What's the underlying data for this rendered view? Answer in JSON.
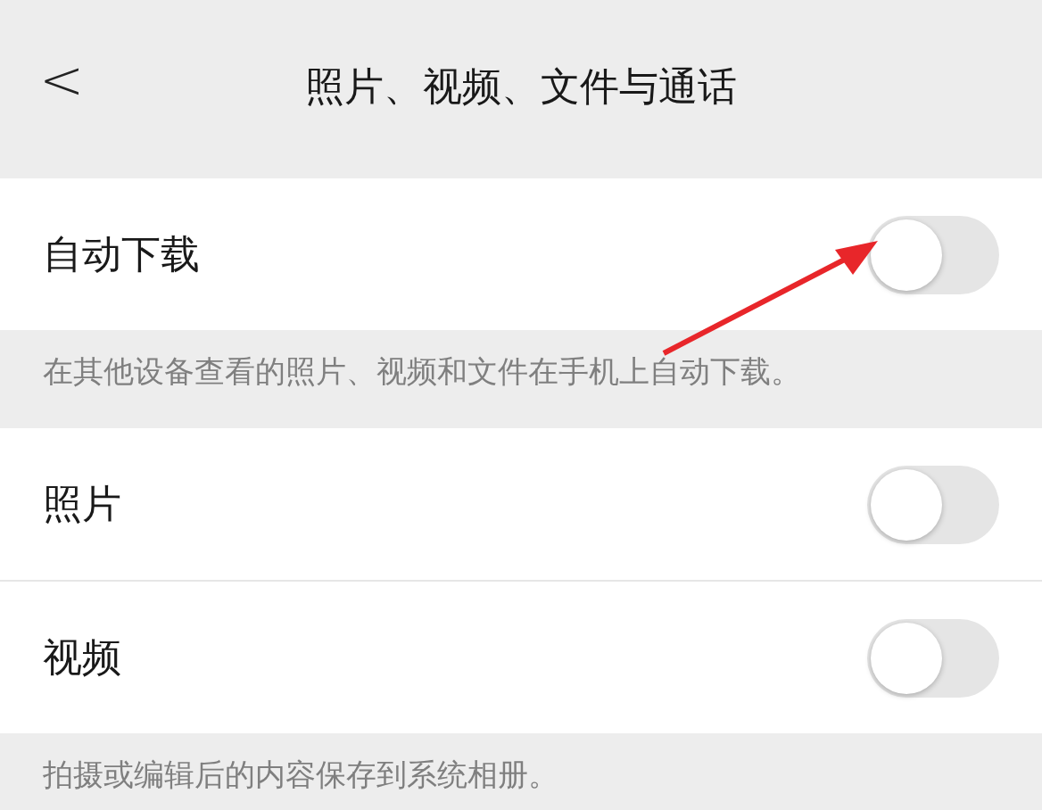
{
  "nav_bar": {
    "back": "<",
    "title": "照片、视频、文件与通话"
  },
  "sections": [
    {
      "rows": [
        {
          "label": "自动下载",
          "on": false
        }
      ],
      "note": "在其他设备查看的照片、视频和文件在手机上自动下载。"
    },
    {
      "rows": [
        {
          "label": "照片",
          "on": false
        },
        {
          "label": "视频",
          "on": false
        }
      ],
      "note": "拍摄或编辑后的内容保存到系统相册。"
    }
  ]
}
